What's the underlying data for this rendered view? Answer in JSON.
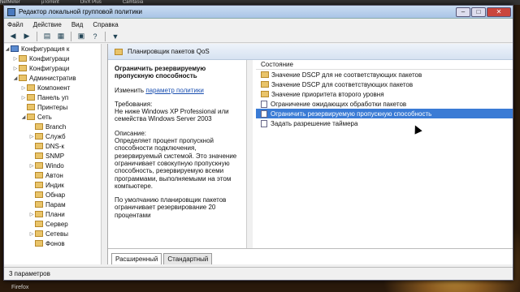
{
  "taskbar": {
    "items": [
      "NetMeter",
      "µTorrent",
      "DivX Plus",
      "Camtasia"
    ]
  },
  "window": {
    "title": "Редактор локальной групповой политики"
  },
  "menu": [
    "Файл",
    "Действие",
    "Вид",
    "Справка"
  ],
  "toolbar_icons": [
    "back-arrow-icon",
    "forward-arrow-icon",
    "up-folder-icon",
    "show-hide-tree-icon",
    "properties-icon",
    "help-icon",
    "filter-icon"
  ],
  "tree": [
    {
      "label": "Конфигурация к",
      "indent": 0,
      "type": "pc",
      "tw": "◢"
    },
    {
      "label": "Конфигураци",
      "indent": 1,
      "type": "fold",
      "tw": "▷"
    },
    {
      "label": "Конфигураци",
      "indent": 1,
      "type": "fold",
      "tw": "▷"
    },
    {
      "label": "Административ",
      "indent": 1,
      "type": "fold",
      "tw": "◢"
    },
    {
      "label": "Компонент",
      "indent": 2,
      "type": "fold",
      "tw": "▷"
    },
    {
      "label": "Панель уп",
      "indent": 2,
      "type": "fold",
      "tw": "▷"
    },
    {
      "label": "Принтеры",
      "indent": 2,
      "type": "fold",
      "tw": ""
    },
    {
      "label": "Сеть",
      "indent": 2,
      "type": "fold",
      "tw": "◢"
    },
    {
      "label": "Branch",
      "indent": 3,
      "type": "fold",
      "tw": ""
    },
    {
      "label": "Служб",
      "indent": 3,
      "type": "fold",
      "tw": "▷"
    },
    {
      "label": "DNS-к",
      "indent": 3,
      "type": "fold",
      "tw": ""
    },
    {
      "label": "SNMP",
      "indent": 3,
      "type": "fold",
      "tw": ""
    },
    {
      "label": "Windo",
      "indent": 3,
      "type": "fold",
      "tw": "▷"
    },
    {
      "label": "Автон",
      "indent": 3,
      "type": "fold",
      "tw": ""
    },
    {
      "label": "Индик",
      "indent": 3,
      "type": "fold",
      "tw": ""
    },
    {
      "label": "Обнар",
      "indent": 3,
      "type": "fold",
      "tw": ""
    },
    {
      "label": "Парам",
      "indent": 3,
      "type": "fold",
      "tw": ""
    },
    {
      "label": "Плани",
      "indent": 3,
      "type": "fold",
      "tw": "▷"
    },
    {
      "label": "Сервер",
      "indent": 3,
      "type": "fold",
      "tw": ""
    },
    {
      "label": "Сетевы",
      "indent": 3,
      "type": "fold",
      "tw": "▷"
    },
    {
      "label": "Фонов",
      "indent": 3,
      "type": "fold",
      "tw": ""
    }
  ],
  "header": {
    "title": "Планировщик пакетов QoS"
  },
  "extended": {
    "policy_title": "Ограничить резервируемую пропускную способность",
    "edit_prefix": "Изменить",
    "edit_link": "параметр политики",
    "req_label": "Требования:",
    "req_text": "Не ниже Windows XP Professional или семейства Windows Server 2003",
    "desc_label": "Описание:",
    "desc_text": "Определяет процент пропускной способности подключения, резервируемый системой. Это значение ограничивает совокупную пропускную способность, резервируемую всеми программами, выполняемыми на этом компьютере.",
    "desc_text2": "По умолчанию планировщик пакетов ограничивает резервирование 20 процентами"
  },
  "list": {
    "column": "Состояние",
    "items": [
      {
        "label": "Значение DSCP для не соответствующих пакетов",
        "type": "fold"
      },
      {
        "label": "Значение DSCP для соответствующих пакетов",
        "type": "fold"
      },
      {
        "label": "Значение приоритета второго уровня",
        "type": "fold"
      },
      {
        "label": "Ограничение ожидающих обработки пакетов",
        "type": "doc"
      },
      {
        "label": "Ограничить резервируемую пропускную способность",
        "type": "doc",
        "selected": true
      },
      {
        "label": "Задать разрешение таймера",
        "type": "doc"
      }
    ]
  },
  "tabs": [
    "Расширенный",
    "Стандартный"
  ],
  "status": "3 параметров",
  "bottom_app": "Firefox"
}
